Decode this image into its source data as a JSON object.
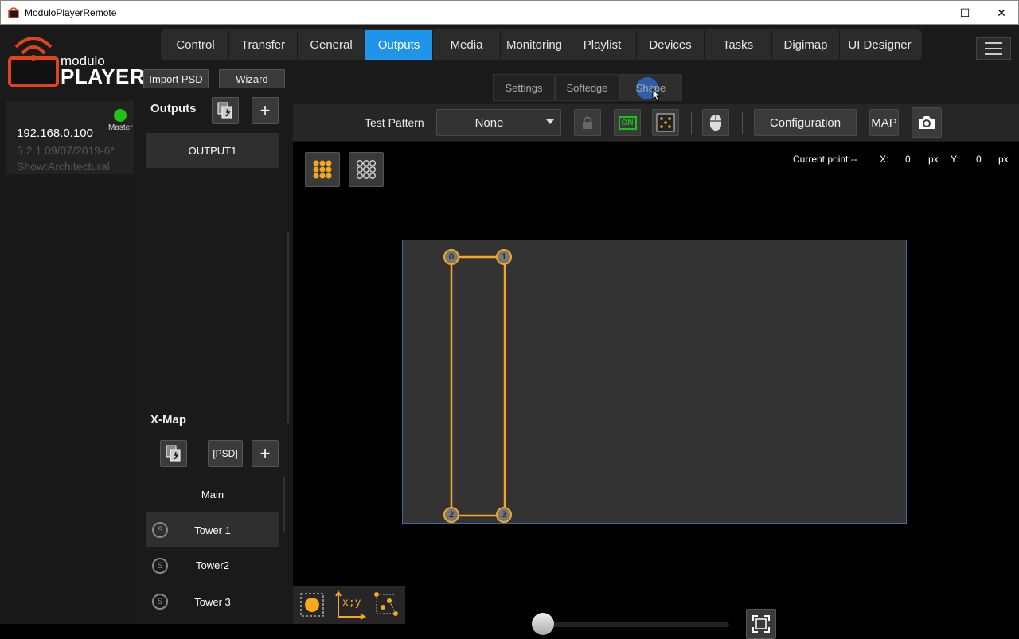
{
  "window": {
    "title": "ModuloPlayerRemote"
  },
  "logo": {
    "word1": "modulo",
    "word2": "PLAYER"
  },
  "top_buttons": {
    "import_psd": "Import PSD",
    "wizard": "Wizard"
  },
  "main_tabs": [
    {
      "label": "Control"
    },
    {
      "label": "Transfer"
    },
    {
      "label": "General"
    },
    {
      "label": "Outputs",
      "active": true
    },
    {
      "label": "Media"
    },
    {
      "label": "Monitoring"
    },
    {
      "label": "Playlist"
    },
    {
      "label": "Devices"
    },
    {
      "label": "Tasks"
    },
    {
      "label": "Digimap"
    },
    {
      "label": "UI Designer"
    }
  ],
  "sub_tabs": [
    {
      "label": "Settings"
    },
    {
      "label": "Softedge"
    },
    {
      "label": "Shape",
      "active": true
    }
  ],
  "device": {
    "ip": "192.168.0.100",
    "role": "Master",
    "version": "5.2.1 09/07/2019-6*",
    "show": "Show:Architectural",
    "status_color": "#22c21a"
  },
  "outputs": {
    "title": "Outputs",
    "items": [
      "OUTPUT1"
    ]
  },
  "xmap": {
    "title": "X-Map",
    "psd_label": "[PSD]",
    "group": "Main",
    "items": [
      "Tower 1",
      "Tower2",
      "Tower 3"
    ]
  },
  "toolbar": {
    "test_pattern_label": "Test Pattern",
    "test_pattern_value": "None",
    "on_label": "ON",
    "configuration": "Configuration",
    "map": "MAP"
  },
  "canvas": {
    "current_point_label": "Current point:--",
    "x_label": "X:",
    "x_value": "0",
    "x_unit": "px",
    "y_label": "Y:",
    "y_value": "0",
    "y_unit": "px",
    "points": [
      "0",
      "1",
      "2",
      "3"
    ]
  },
  "bottom": {
    "xy_label": "x;y"
  },
  "colors": {
    "accent": "#1e95ea",
    "shape": "#f5a623",
    "on": "#19c219"
  }
}
